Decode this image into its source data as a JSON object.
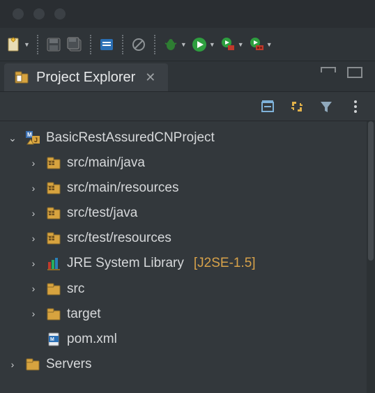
{
  "tab": {
    "title": "Project Explorer"
  },
  "tree": {
    "root": {
      "label": "BasicRestAssuredCNProject",
      "expanded": true,
      "children": [
        {
          "kind": "package",
          "label": "src/main/java"
        },
        {
          "kind": "package",
          "label": "src/main/resources"
        },
        {
          "kind": "package",
          "label": "src/test/java"
        },
        {
          "kind": "package",
          "label": "src/test/resources"
        },
        {
          "kind": "jre",
          "label": "JRE System Library",
          "suffix": "[J2SE-1.5]"
        },
        {
          "kind": "folder",
          "label": "src"
        },
        {
          "kind": "folder",
          "label": "target"
        },
        {
          "kind": "file",
          "label": "pom.xml",
          "leaf": true
        }
      ]
    },
    "sibling": {
      "label": "Servers"
    }
  }
}
